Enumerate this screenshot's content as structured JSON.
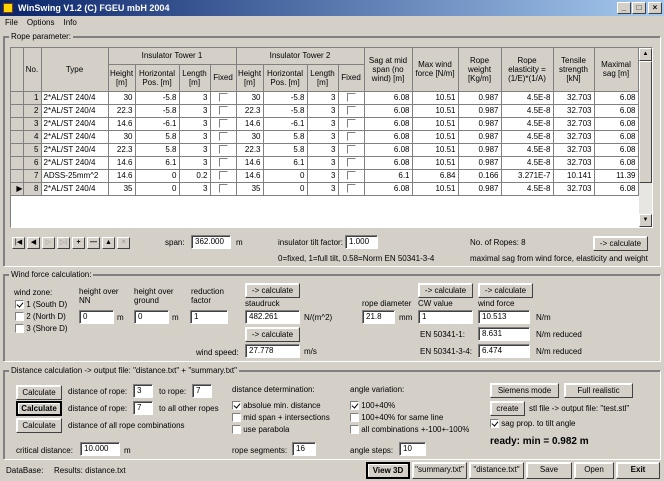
{
  "window": {
    "title": "WinSwing V1.2 (C) FGEU mbH 2004"
  },
  "menu": [
    "File",
    "Options",
    "Info"
  ],
  "rope": {
    "legend": "Rope parameter:",
    "headers": {
      "no": "No.",
      "type": "Type",
      "it1": "Insulator Tower 1",
      "it2": "Insulator Tower 2",
      "height": "Height [m]",
      "hpos": "Horizontal Pos. [m]",
      "length": "Length [m]",
      "fixed": "Fixed",
      "sag": "Sag at mid span (no wind) [m]",
      "maxwind": "Max wind force [N/m]",
      "weight": "Rope weight [Kg/m]",
      "elast": "Rope elasticity = (1/E)*(1/A)",
      "tensile": "Tensile strength [kN]",
      "maxsag": "Maximal sag [m]"
    },
    "rows": [
      [
        "1",
        "2*AL/ST 240/4",
        "30",
        "-5.8",
        "3",
        "30",
        "-5.8",
        "3",
        "6.08",
        "10.51",
        "0.987",
        "4.5E-8",
        "32.703",
        "6.08"
      ],
      [
        "2",
        "2*AL/ST 240/4",
        "22.3",
        "-5.8",
        "3",
        "22.3",
        "-5.8",
        "3",
        "6.08",
        "10.51",
        "0.987",
        "4.5E-8",
        "32.703",
        "6.08"
      ],
      [
        "3",
        "2*AL/ST 240/4",
        "14.6",
        "-6.1",
        "3",
        "14.6",
        "-6.1",
        "3",
        "6.08",
        "10.51",
        "0.987",
        "4.5E-8",
        "32.703",
        "6.08"
      ],
      [
        "4",
        "2*AL/ST 240/4",
        "30",
        "5.8",
        "3",
        "30",
        "5.8",
        "3",
        "6.08",
        "10.51",
        "0.987",
        "4.5E-8",
        "32.703",
        "6.08"
      ],
      [
        "5",
        "2*AL/ST 240/4",
        "22.3",
        "5.8",
        "3",
        "22.3",
        "5.8",
        "3",
        "6.08",
        "10.51",
        "0.987",
        "4.5E-8",
        "32.703",
        "6.08"
      ],
      [
        "6",
        "2*AL/ST 240/4",
        "14.6",
        "6.1",
        "3",
        "14.6",
        "6.1",
        "3",
        "6.08",
        "10.51",
        "0.987",
        "4.5E-8",
        "32.703",
        "6.08"
      ],
      [
        "7",
        "ADSS-25mm^2",
        "14.6",
        "0",
        "0.2",
        "14.6",
        "0",
        "3",
        "6.1",
        "6.84",
        "0.166",
        "3.271E-7",
        "10.141",
        "11.39"
      ],
      [
        "8",
        "2*AL/ST 240/4",
        "35",
        "0",
        "3",
        "35",
        "0",
        "3",
        "6.08",
        "10.51",
        "0.987",
        "4.5E-8",
        "32.703",
        "6.08"
      ]
    ],
    "span_label": "span:",
    "span_value": "362.000",
    "span_unit": "m",
    "tilt_label": "insulator tilt factor:",
    "tilt_value": "1.000",
    "tilt_note": "0=fixed, 1=full tilt, 0.58=Norm EN 50341-3-4",
    "num_ropes": "No. of Ropes: 8",
    "calc": "-> calculate",
    "maxsag_note": "maximal sag from wind force, elasticity and weight"
  },
  "wind": {
    "legend": "Wind force calculation:",
    "zone_label": "wind zone:",
    "zones": [
      "1 (South D)",
      "2 (North D)",
      "3 (Shore D)"
    ],
    "height_nn": "height over NN",
    "height_nn_value": "0",
    "m": "m",
    "height_ground": "height over ground",
    "height_ground_value": "0",
    "reduction": "reduction factor",
    "reduction_value": "1",
    "calc": "-> calculate",
    "staudruck": "staudruck",
    "staudruck_value": "482.261",
    "staudruck_unit": "N/(m^2)",
    "windspeed_label": "wind speed:",
    "windspeed_value": "27.778",
    "windspeed_unit": "m/s",
    "rope_diameter": "rope diameter",
    "rope_diameter_value": "21.8",
    "mm": "mm",
    "cw": "CW value",
    "cw_value": "1",
    "windforce": "wind force",
    "windforce_value": "10.513",
    "nm": "N/m",
    "en1_label": "EN 50341-1:",
    "en1_value": "8.631",
    "en1_unit": "N/m reduced",
    "en2_label": "EN 50341-3-4:",
    "en2_value": "6.474",
    "en2_unit": "N/m reduced"
  },
  "dist": {
    "legend": "Distance calculation -> output file: \"distance.txt\" + \"summary.txt\"",
    "calculate": "Calculate",
    "dist_of_rope": "distance of rope:",
    "from1": "3",
    "to_rope": "to rope:",
    "to1": "7",
    "from2": "7",
    "to_all": "to all other ropes",
    "all_combos": "distance of all rope combinations",
    "critical_label": "critical distance:",
    "critical_value": "10.000",
    "critical_unit": "m",
    "determination": "distance determination:",
    "det_opts": [
      "absolue min. distance",
      "mid span + intersections",
      "use parabola"
    ],
    "segments_label": "rope segments:",
    "segments_value": "16",
    "angle_var": "angle variation:",
    "angle_opts": [
      "100+40%",
      "100+40% for same line",
      "all combinations +-100+-100%"
    ],
    "steps_label": "angle steps:",
    "steps_value": "10",
    "siemens": "Siemens mode",
    "full": "Full realistic",
    "create": "create",
    "stl_note": "stl file -> output file: \"test.stl\"",
    "sagprop": "sag prop. to tilt angle",
    "ready": "ready:  min = 0.982 m"
  },
  "status": {
    "database": "DataBase:",
    "results": "Results: distance.txt",
    "view3d": "View 3D",
    "summary": "\"summary.txt\"",
    "distance": "\"distance.txt\"",
    "save": "Save",
    "open": "Open",
    "exit": "Exit"
  }
}
